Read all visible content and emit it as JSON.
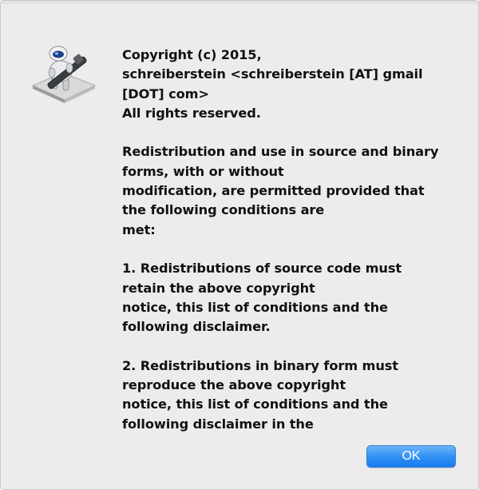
{
  "dialog": {
    "icon": "automator-robot-icon",
    "message_lines": [
      "Copyright (c) 2015,",
      "schreiberstein <schreiberstein [AT] gmail",
      "[DOT] com>",
      "All rights reserved.",
      "",
      "Redistribution and use in source and binary",
      "forms, with or without",
      "modification, are permitted provided that",
      "the following conditions are",
      "met:",
      "",
      "1. Redistributions of source code must",
      "retain the above copyright",
      "notice, this list of conditions and the",
      "following disclaimer.",
      "",
      "2. Redistributions in binary form must",
      "reproduce the above copyright",
      "notice, this list of conditions and the",
      "following disclaimer in the"
    ],
    "ok_label": "OK",
    "accent_color": "#2f8ef5"
  }
}
